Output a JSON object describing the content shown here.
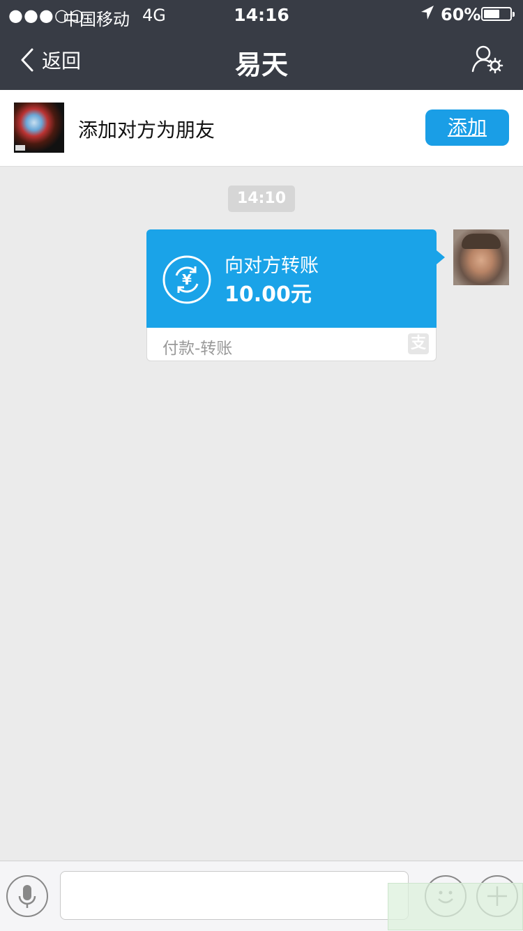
{
  "status_bar": {
    "signal": "●●●○○",
    "carrier": "中国移动",
    "network": "4G",
    "time": "14:16",
    "battery": "60%",
    "battery_level": 0.6
  },
  "nav": {
    "back_label": "返回",
    "title": "易天"
  },
  "add_banner": {
    "text": "添加对方为朋友",
    "button_label": "添加"
  },
  "chat": {
    "timestamp": "14:10",
    "transfer": {
      "label": "向对方转账",
      "amount": "10.00元",
      "footer": "付款-转账",
      "logo_char": "支"
    }
  },
  "colors": {
    "nav_bg": "#383c45",
    "accent": "#1aa3e8",
    "chat_bg": "#ebebeb"
  },
  "icons": {
    "back": "chevron-left-icon",
    "settings": "user-settings-icon",
    "transfer": "yuan-transfer-icon",
    "voice": "microphone-icon",
    "emoji": "emoji-icon",
    "plus": "plus-icon"
  }
}
